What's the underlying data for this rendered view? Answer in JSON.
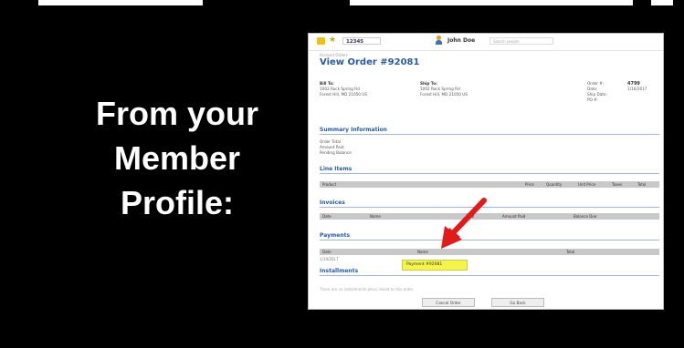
{
  "slide": {
    "caption_lines": [
      "From your",
      "Member",
      "Profile:"
    ]
  },
  "app": {
    "account_number": "12345",
    "user_name": "John Doe",
    "search_placeholder": "Search people",
    "breadcrumb": "Account Orders",
    "page_title": "View Order #92081"
  },
  "order": {
    "bill_to": {
      "label": "Bill To:",
      "line1": "1002 Rock Spring Rd",
      "line2": "Forest Hill, MD 21050 US"
    },
    "ship_to": {
      "label": "Ship To:",
      "line1": "1002 Rock Spring Rd",
      "line2": "Forest Hill, MD 21050 US"
    },
    "meta": [
      {
        "key": "Order #:",
        "value": "4799"
      },
      {
        "key": "Date:",
        "value": "1/10/2017"
      },
      {
        "key": "Ship Date:",
        "value": ""
      },
      {
        "key": "PO #:",
        "value": ""
      }
    ]
  },
  "sections": {
    "summary": "Summary Information",
    "summary_lines": [
      "Order Total",
      "Amount Paid",
      "Pending Balance"
    ],
    "line_items": "Line Items",
    "line_items_columns": [
      "Product",
      "Price",
      "Quantity",
      "Unit Price",
      "Taxes",
      "Total"
    ],
    "invoices": "Invoices",
    "invoices_columns": [
      "Date",
      "Name",
      "Total",
      "Amount Paid",
      "Balance Due"
    ],
    "payments": "Payments",
    "payments_columns": [
      "Date",
      "Name",
      "Total"
    ],
    "payment_date": "1/10/2017",
    "payment_link": "Payment #92081",
    "installments": "Installments",
    "installments_note": "There are no installments plans linked to this order.",
    "cancel_button": "Cancel Order",
    "go_back_button": "Go Back"
  },
  "colors": {
    "title_blue": "#2a5aa0",
    "highlight_yellow": "#f4f44a",
    "arrow_red": "#e01b1b"
  }
}
